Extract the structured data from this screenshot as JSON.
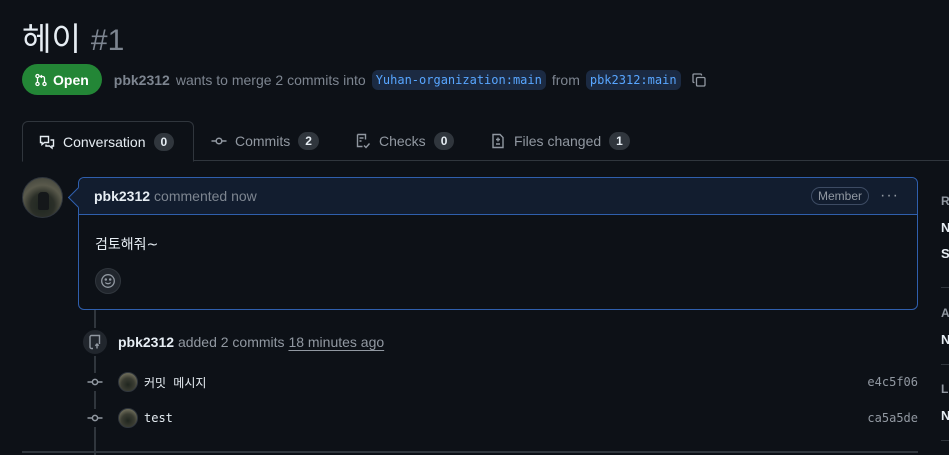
{
  "pr": {
    "title": "헤이",
    "number": "#1",
    "state": "Open",
    "author": "pbk2312",
    "merge_text": "wants to merge 2 commits into",
    "base_branch": "Yuhan-organization:main",
    "from_text": "from",
    "head_branch": "pbk2312:main"
  },
  "tabs": [
    {
      "label": "Conversation",
      "count": "0",
      "icon": "comment-discussion-icon"
    },
    {
      "label": "Commits",
      "count": "2",
      "icon": "git-commit-icon"
    },
    {
      "label": "Checks",
      "count": "0",
      "icon": "checklist-icon"
    },
    {
      "label": "Files changed",
      "count": "1",
      "icon": "file-diff-icon"
    }
  ],
  "comment": {
    "author": "pbk2312",
    "time": "commented now",
    "role": "Member",
    "body": "검토해줘~",
    "menu": "···"
  },
  "event": {
    "author": "pbk2312",
    "action": "added 2 commits",
    "time": "18 minutes ago"
  },
  "commits": [
    {
      "message": "커밋 메시지",
      "sha": "e4c5f06"
    },
    {
      "message": "test",
      "sha": "ca5a5de"
    }
  ],
  "sidebar": {
    "r1": "R",
    "r2": "N",
    "r3": "S",
    "a1": "A",
    "a2": "N",
    "l1": "L",
    "l2": "N"
  },
  "colors": {
    "open_green": "#238636",
    "link_blue": "#58a6ff",
    "background": "#0d1117"
  }
}
